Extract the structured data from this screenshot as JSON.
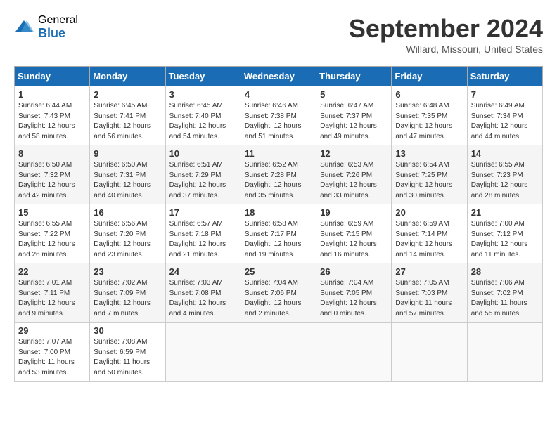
{
  "logo": {
    "general": "General",
    "blue": "Blue"
  },
  "title": "September 2024",
  "location": "Willard, Missouri, United States",
  "weekdays": [
    "Sunday",
    "Monday",
    "Tuesday",
    "Wednesday",
    "Thursday",
    "Friday",
    "Saturday"
  ],
  "weeks": [
    [
      {
        "day": "1",
        "sunrise": "6:44 AM",
        "sunset": "7:43 PM",
        "daylight": "12 hours and 58 minutes."
      },
      {
        "day": "2",
        "sunrise": "6:45 AM",
        "sunset": "7:41 PM",
        "daylight": "12 hours and 56 minutes."
      },
      {
        "day": "3",
        "sunrise": "6:45 AM",
        "sunset": "7:40 PM",
        "daylight": "12 hours and 54 minutes."
      },
      {
        "day": "4",
        "sunrise": "6:46 AM",
        "sunset": "7:38 PM",
        "daylight": "12 hours and 51 minutes."
      },
      {
        "day": "5",
        "sunrise": "6:47 AM",
        "sunset": "7:37 PM",
        "daylight": "12 hours and 49 minutes."
      },
      {
        "day": "6",
        "sunrise": "6:48 AM",
        "sunset": "7:35 PM",
        "daylight": "12 hours and 47 minutes."
      },
      {
        "day": "7",
        "sunrise": "6:49 AM",
        "sunset": "7:34 PM",
        "daylight": "12 hours and 44 minutes."
      }
    ],
    [
      {
        "day": "8",
        "sunrise": "6:50 AM",
        "sunset": "7:32 PM",
        "daylight": "12 hours and 42 minutes."
      },
      {
        "day": "9",
        "sunrise": "6:50 AM",
        "sunset": "7:31 PM",
        "daylight": "12 hours and 40 minutes."
      },
      {
        "day": "10",
        "sunrise": "6:51 AM",
        "sunset": "7:29 PM",
        "daylight": "12 hours and 37 minutes."
      },
      {
        "day": "11",
        "sunrise": "6:52 AM",
        "sunset": "7:28 PM",
        "daylight": "12 hours and 35 minutes."
      },
      {
        "day": "12",
        "sunrise": "6:53 AM",
        "sunset": "7:26 PM",
        "daylight": "12 hours and 33 minutes."
      },
      {
        "day": "13",
        "sunrise": "6:54 AM",
        "sunset": "7:25 PM",
        "daylight": "12 hours and 30 minutes."
      },
      {
        "day": "14",
        "sunrise": "6:55 AM",
        "sunset": "7:23 PM",
        "daylight": "12 hours and 28 minutes."
      }
    ],
    [
      {
        "day": "15",
        "sunrise": "6:55 AM",
        "sunset": "7:22 PM",
        "daylight": "12 hours and 26 minutes."
      },
      {
        "day": "16",
        "sunrise": "6:56 AM",
        "sunset": "7:20 PM",
        "daylight": "12 hours and 23 minutes."
      },
      {
        "day": "17",
        "sunrise": "6:57 AM",
        "sunset": "7:18 PM",
        "daylight": "12 hours and 21 minutes."
      },
      {
        "day": "18",
        "sunrise": "6:58 AM",
        "sunset": "7:17 PM",
        "daylight": "12 hours and 19 minutes."
      },
      {
        "day": "19",
        "sunrise": "6:59 AM",
        "sunset": "7:15 PM",
        "daylight": "12 hours and 16 minutes."
      },
      {
        "day": "20",
        "sunrise": "6:59 AM",
        "sunset": "7:14 PM",
        "daylight": "12 hours and 14 minutes."
      },
      {
        "day": "21",
        "sunrise": "7:00 AM",
        "sunset": "7:12 PM",
        "daylight": "12 hours and 11 minutes."
      }
    ],
    [
      {
        "day": "22",
        "sunrise": "7:01 AM",
        "sunset": "7:11 PM",
        "daylight": "12 hours and 9 minutes."
      },
      {
        "day": "23",
        "sunrise": "7:02 AM",
        "sunset": "7:09 PM",
        "daylight": "12 hours and 7 minutes."
      },
      {
        "day": "24",
        "sunrise": "7:03 AM",
        "sunset": "7:08 PM",
        "daylight": "12 hours and 4 minutes."
      },
      {
        "day": "25",
        "sunrise": "7:04 AM",
        "sunset": "7:06 PM",
        "daylight": "12 hours and 2 minutes."
      },
      {
        "day": "26",
        "sunrise": "7:04 AM",
        "sunset": "7:05 PM",
        "daylight": "12 hours and 0 minutes."
      },
      {
        "day": "27",
        "sunrise": "7:05 AM",
        "sunset": "7:03 PM",
        "daylight": "11 hours and 57 minutes."
      },
      {
        "day": "28",
        "sunrise": "7:06 AM",
        "sunset": "7:02 PM",
        "daylight": "11 hours and 55 minutes."
      }
    ],
    [
      {
        "day": "29",
        "sunrise": "7:07 AM",
        "sunset": "7:00 PM",
        "daylight": "11 hours and 53 minutes."
      },
      {
        "day": "30",
        "sunrise": "7:08 AM",
        "sunset": "6:59 PM",
        "daylight": "11 hours and 50 minutes."
      },
      null,
      null,
      null,
      null,
      null
    ]
  ]
}
